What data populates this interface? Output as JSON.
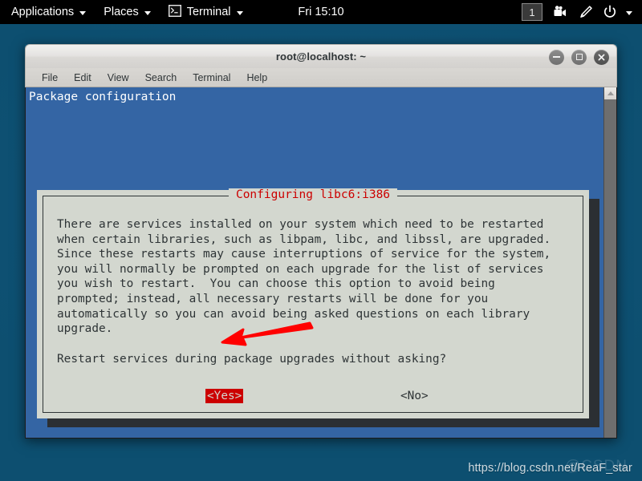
{
  "top_panel": {
    "applications_label": "Applications",
    "places_label": "Places",
    "terminal_label": "Terminal",
    "clock": "Fri 15:10",
    "workspace": "1",
    "icons": {
      "terminal": "terminal-icon",
      "screencast": "screencast-icon",
      "pen": "pen-icon",
      "power": "power-icon"
    }
  },
  "window": {
    "title": "root@localhost: ~",
    "buttons": {
      "minimize": "minimize",
      "maximize": "maximize",
      "close": "close"
    },
    "menu": [
      "File",
      "Edit",
      "View",
      "Search",
      "Terminal",
      "Help"
    ]
  },
  "terminal": {
    "header": "Package configuration",
    "background_color": "#3465a4"
  },
  "dialog": {
    "title": "Configuring libc6:i386",
    "title_color": "#cc0000",
    "body": "There are services installed on your system which need to be restarted\nwhen certain libraries, such as libpam, libc, and libssl, are upgraded.\nSince these restarts may cause interruptions of service for the system,\nyou will normally be prompted on each upgrade for the list of services\nyou wish to restart.  You can choose this option to avoid being\nprompted; instead, all necessary restarts will be done for you\nautomatically so you can avoid being asked questions on each library\nupgrade.",
    "question": "Restart services during package upgrades without asking?",
    "buttons": {
      "yes": "<Yes>",
      "no": "<No>"
    },
    "selected_button": "<Yes>",
    "selection_color": "#cc0000",
    "background_color": "#d3d7cf"
  },
  "annotation": {
    "arrow_color": "#ff0000",
    "points_to": "<Yes>"
  },
  "watermark": {
    "text": "https://blog.csdn.net/ReaF_star"
  }
}
